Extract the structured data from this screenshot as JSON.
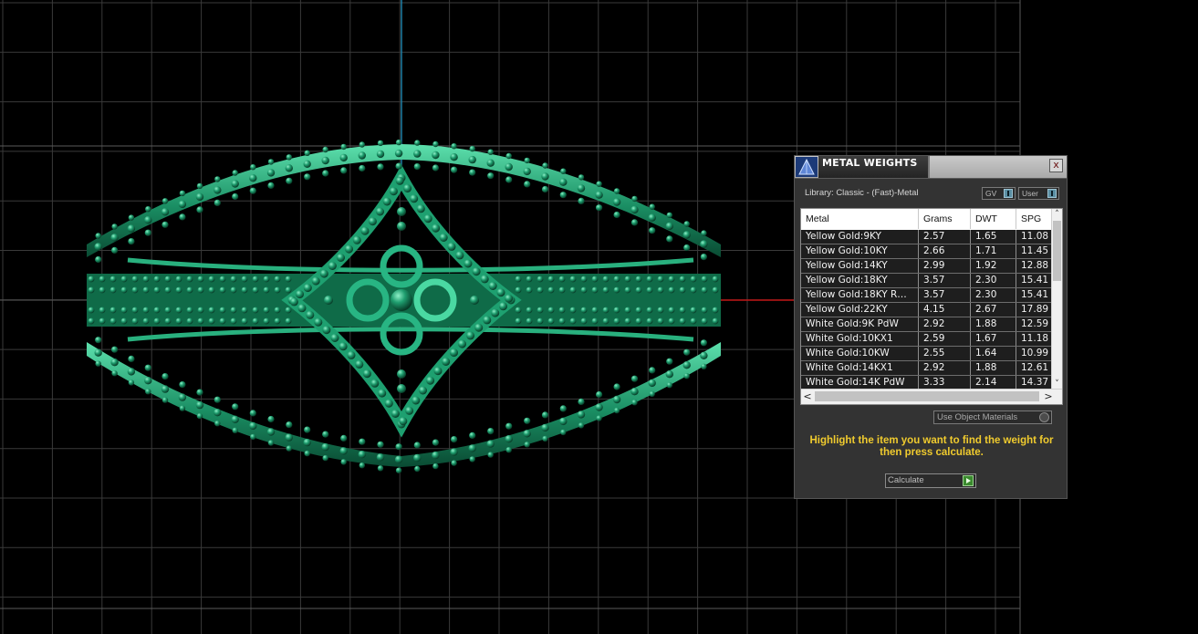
{
  "viewport": {
    "grid_color": "#3a3a3a",
    "axis_colors": {
      "vertical": "#1e7fa6",
      "horizontal": "#c01515"
    },
    "model_color": "#1b9a6e"
  },
  "panel": {
    "title": "METAL WEIGHTS",
    "logo_icon": "pyramid-logo-icon",
    "close_icon": "x",
    "library_label": "Library: Classic - (Fast)-Metal",
    "toggle_gv_label": "GV",
    "toggle_user_label": "User",
    "table": {
      "headers": [
        "Metal",
        "Grams",
        "DWT",
        "SPG"
      ],
      "rows": [
        [
          "Yellow Gold:9KY",
          "2.57",
          "1.65",
          "11.08"
        ],
        [
          "Yellow Gold:10KY",
          "2.66",
          "1.71",
          "11.45"
        ],
        [
          "Yellow Gold:14KY",
          "2.99",
          "1.92",
          "12.88"
        ],
        [
          "Yellow Gold:18KY",
          "3.57",
          "2.30",
          "15.41"
        ],
        [
          "Yellow Gold:18KY R…",
          "3.57",
          "2.30",
          "15.41"
        ],
        [
          "Yellow Gold:22KY",
          "4.15",
          "2.67",
          "17.89"
        ],
        [
          "White Gold:9K PdW",
          "2.92",
          "1.88",
          "12.59"
        ],
        [
          "White Gold:10KX1",
          "2.59",
          "1.67",
          "11.18"
        ],
        [
          "White Gold:10KW",
          "2.55",
          "1.64",
          "10.99"
        ],
        [
          "White Gold:14KX1",
          "2.92",
          "1.88",
          "12.61"
        ],
        [
          "White Gold:14K PdW",
          "3.33",
          "2.14",
          "14.37"
        ]
      ],
      "scroll_up": "˄",
      "scroll_down": "˅",
      "scroll_left": "<",
      "scroll_right": ">"
    },
    "use_object_materials_label": "Use Object Materials",
    "hint_text": "Highlight the item you want to find the weight for then press calculate.",
    "calculate_label": "Calculate",
    "accent_color": "#f0cb2e"
  }
}
